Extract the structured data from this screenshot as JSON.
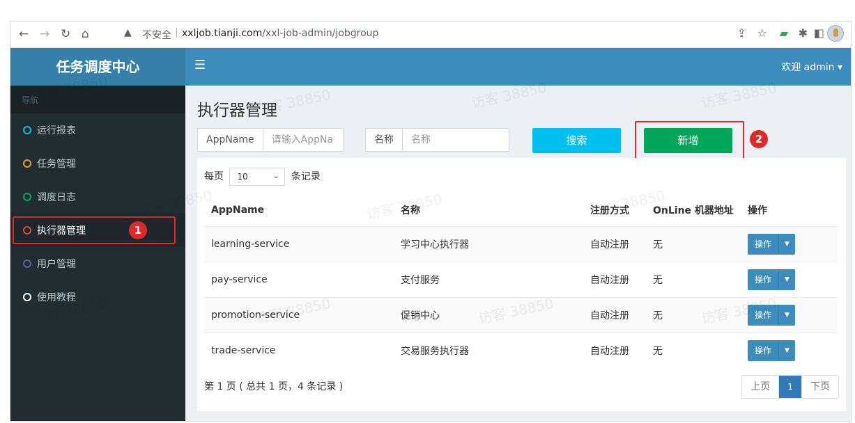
{
  "browser": {
    "insecure_label": "不安全",
    "url_host": "xxljob.tianji.com",
    "url_path": "/xxl-job-admin/jobgroup"
  },
  "header": {
    "logo": "任务调度中心",
    "welcome": "欢迎 admin ▾"
  },
  "sidebar": {
    "nav_header": "导航",
    "items": [
      {
        "label": "运行报表",
        "color": "#00c0ef"
      },
      {
        "label": "任务管理",
        "color": "#f39c12"
      },
      {
        "label": "调度日志",
        "color": "#00a65a"
      },
      {
        "label": "执行器管理",
        "color": "#dd4b39"
      },
      {
        "label": "用户管理",
        "color": "#605ca8"
      },
      {
        "label": "使用教程",
        "color": "#ffffff"
      }
    ]
  },
  "main": {
    "title": "执行器管理",
    "filter_appname_label": "AppName",
    "filter_appname_placeholder": "请输入AppNa",
    "filter_title_label": "名称",
    "filter_title_placeholder": "名称",
    "search_label": "搜索",
    "add_label": "新增",
    "perpage_prefix": "每页",
    "perpage_value": "10",
    "perpage_suffix": "条记录",
    "columns": [
      "AppName",
      "名称",
      "注册方式",
      "OnLine 机器地址",
      "操作"
    ],
    "rows": [
      {
        "appname": "learning-service",
        "title": "学习中心执行器",
        "reg": "自动注册",
        "online": "无",
        "op": "操作"
      },
      {
        "appname": "pay-service",
        "title": "支付服务",
        "reg": "自动注册",
        "online": "无",
        "op": "操作"
      },
      {
        "appname": "promotion-service",
        "title": "促销中心",
        "reg": "自动注册",
        "online": "无",
        "op": "操作"
      },
      {
        "appname": "trade-service",
        "title": "交易服务执行器",
        "reg": "自动注册",
        "online": "无",
        "op": "操作"
      }
    ],
    "summary": "第 1 页 ( 总共 1 页，4 条记录 )",
    "pager": {
      "prev": "上页",
      "current": "1",
      "next": "下页"
    }
  },
  "annotations": {
    "badge1": "1",
    "badge2": "2"
  },
  "watermark": "访客 38850"
}
